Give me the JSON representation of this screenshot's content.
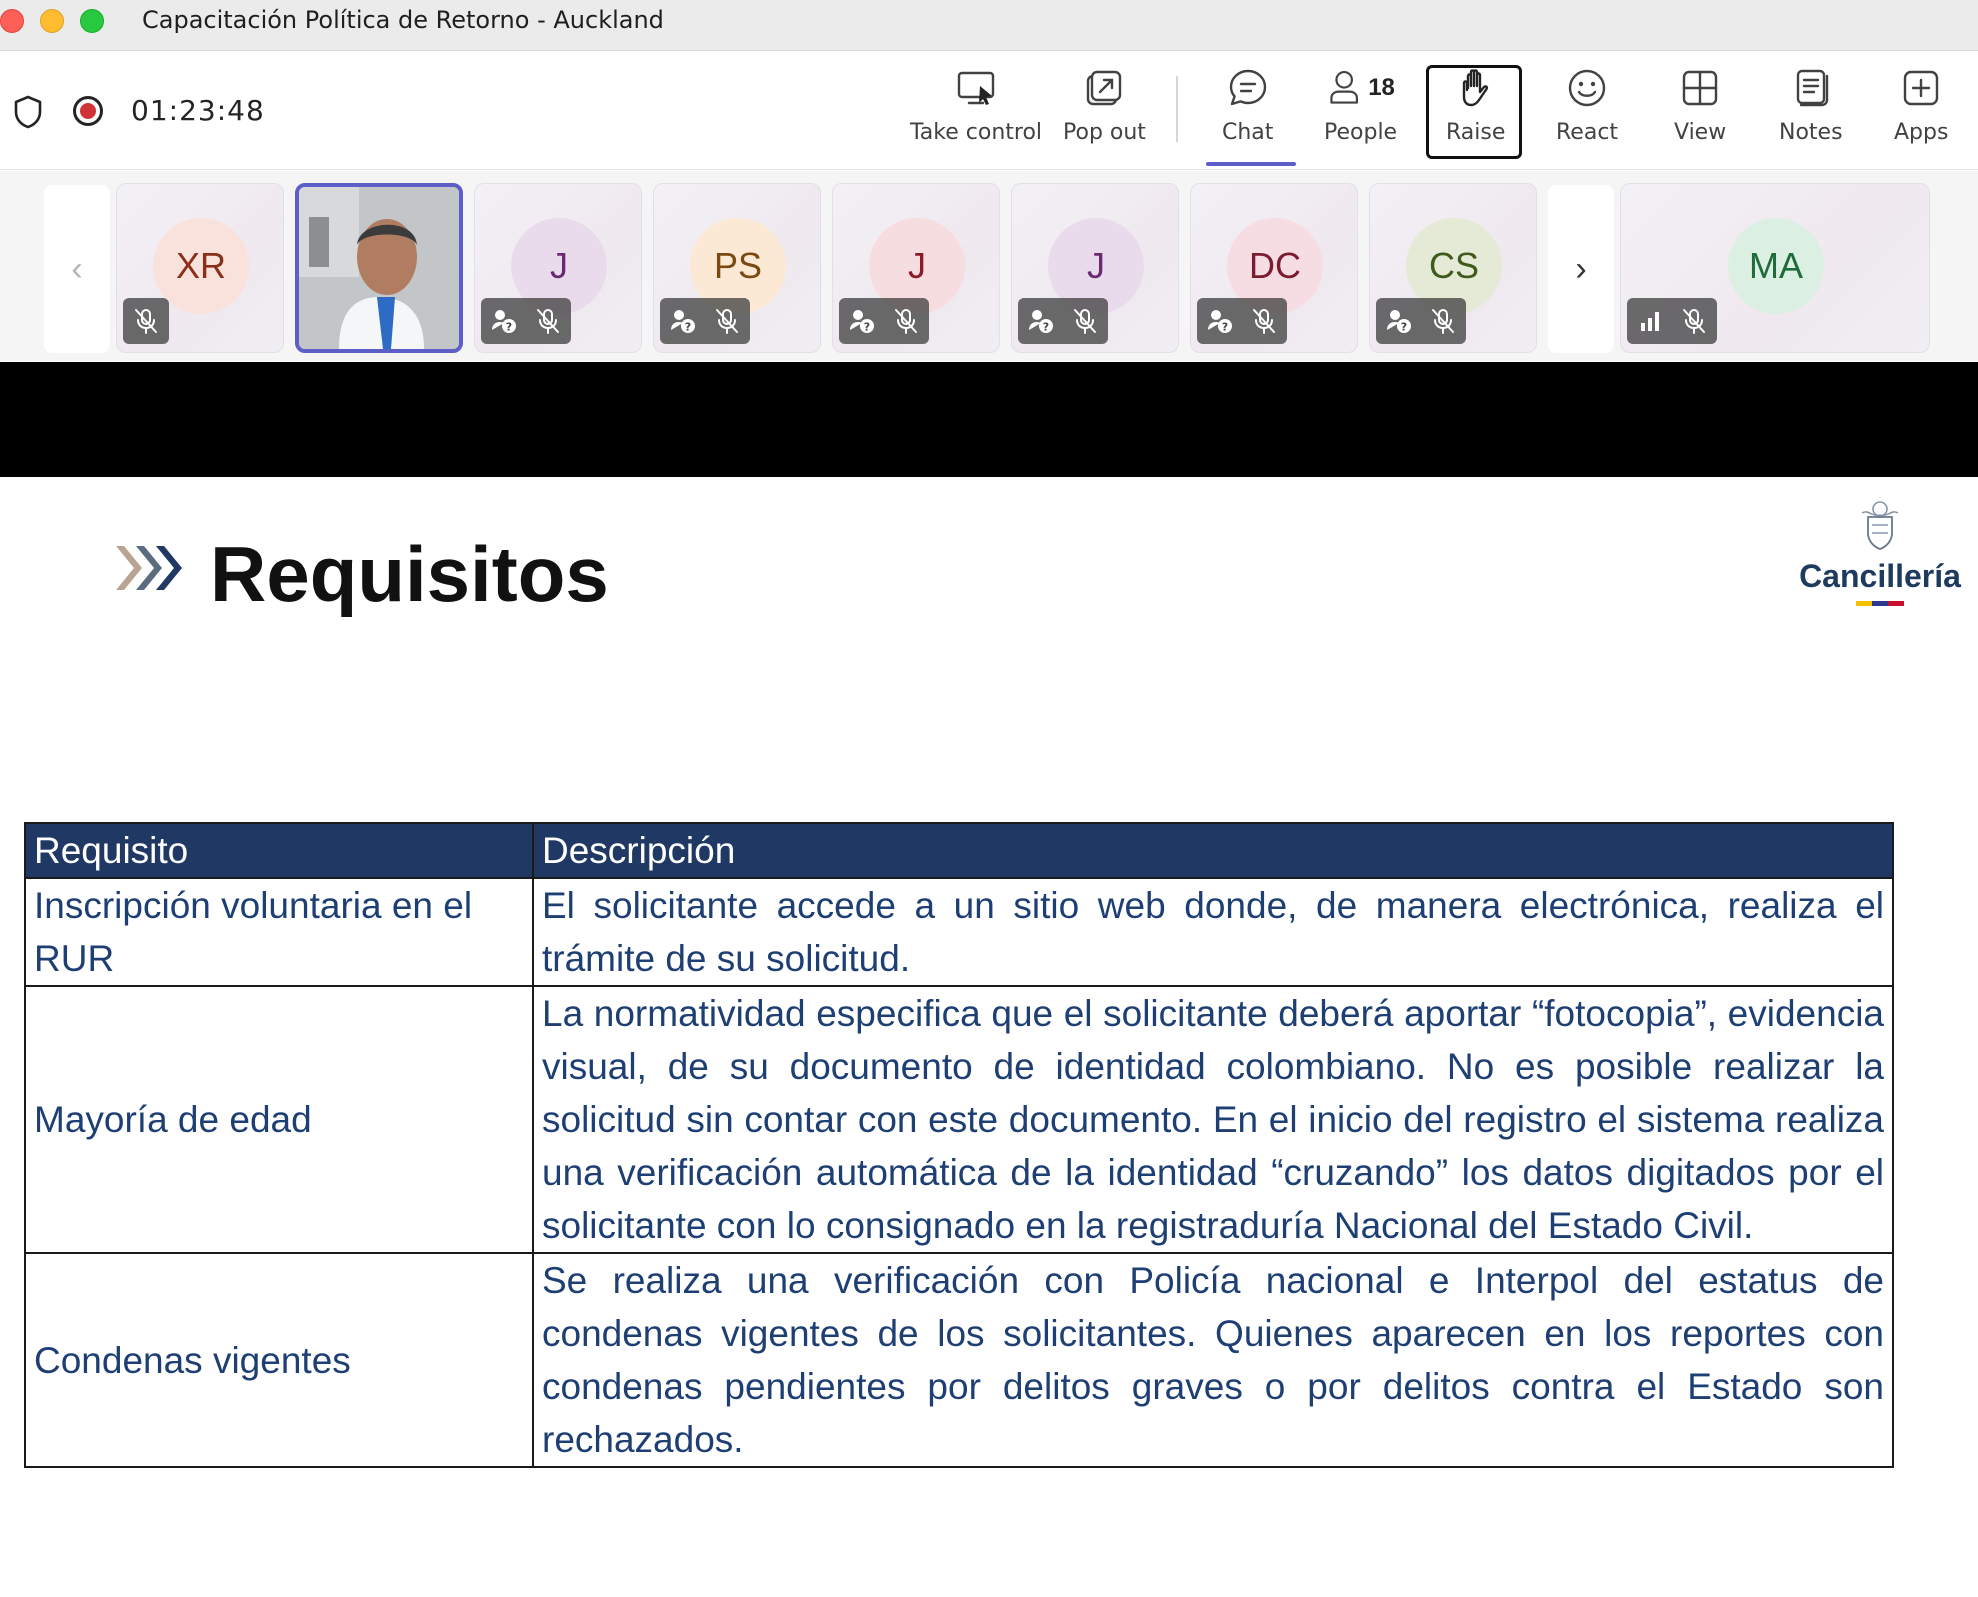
{
  "window": {
    "title": "Capacitación Política de Retorno - Auckland"
  },
  "toolbar": {
    "timer": "01:23:48",
    "buttons": [
      {
        "label": "Take control",
        "icon": "take-control-icon"
      },
      {
        "label": "Pop out",
        "icon": "pop-out-icon"
      },
      {
        "label": "Chat",
        "icon": "chat-icon"
      },
      {
        "label": "People",
        "icon": "people-icon",
        "count": "18"
      },
      {
        "label": "Raise",
        "icon": "raise-hand-icon"
      },
      {
        "label": "React",
        "icon": "react-icon"
      },
      {
        "label": "View",
        "icon": "view-icon"
      },
      {
        "label": "Notes",
        "icon": "notes-icon"
      },
      {
        "label": "Apps",
        "icon": "apps-icon"
      }
    ]
  },
  "gallery": {
    "participants": [
      {
        "initials": "XR",
        "bg": "#f9e2dc",
        "fg": "#8a2f1a",
        "badges": [
          "mic-off-icon"
        ]
      },
      {
        "initials": "",
        "video": true,
        "active": true
      },
      {
        "initials": "J",
        "bg": "#eadbec",
        "fg": "#6b2a70",
        "badges": [
          "status-icon",
          "mic-off-icon"
        ]
      },
      {
        "initials": "PS",
        "bg": "#fbe9d6",
        "fg": "#7a4a10",
        "badges": [
          "status-icon",
          "mic-off-icon"
        ]
      },
      {
        "initials": "J",
        "bg": "#f6dde0",
        "fg": "#8b1a2b",
        "badges": [
          "status-icon",
          "mic-off-icon"
        ]
      },
      {
        "initials": "J",
        "bg": "#eadbec",
        "fg": "#6b2a70",
        "badges": [
          "status-icon",
          "mic-off-icon"
        ]
      },
      {
        "initials": "DC",
        "bg": "#f6dde3",
        "fg": "#7b1c30",
        "badges": [
          "status-icon",
          "mic-off-icon"
        ]
      },
      {
        "initials": "CS",
        "bg": "#e5ead6",
        "fg": "#3f5a1a",
        "badges": [
          "status-icon",
          "mic-off-icon"
        ]
      },
      {
        "initials": "MA",
        "bg": "#dcefe3",
        "fg": "#1f6b3a",
        "badges": [
          "signal-icon",
          "mic-off-icon"
        ]
      }
    ],
    "prev_arrow": "‹",
    "next_arrow": "›"
  },
  "slide": {
    "title": "Requisitos",
    "logo_text": "Cancillería",
    "table": {
      "headers": [
        "Requisito",
        "Descripción"
      ],
      "rows": [
        {
          "requisito": "Inscripción voluntaria en el RUR",
          "descripcion": "El solicitante accede a un sitio web donde, de manera electrónica, realiza el trámite de su solicitud."
        },
        {
          "requisito": "Mayoría de edad",
          "descripcion": "La normatividad especifica que el solicitante deberá aportar “fotocopia”, evidencia visual, de su documento de identidad colombiano. No es posible realizar la solicitud sin contar con este documento. En el inicio del registro el sistema realiza una verificación automática de la identidad “cruzando” los datos digitados por el solicitante con lo consignado en la registraduría Nacional del Estado Civil."
        },
        {
          "requisito": "Condenas vigentes",
          "descripcion": "Se realiza una verificación con Policía nacional e Interpol del estatus de condenas vigentes de los solicitantes. Quienes aparecen en los reportes con condenas pendientes por delitos graves o por delitos contra el Estado son rechazados."
        }
      ]
    }
  },
  "colors": {
    "accent": "#5b5fc7",
    "table_header": "#1f3864",
    "table_text": "#1e3f73"
  }
}
